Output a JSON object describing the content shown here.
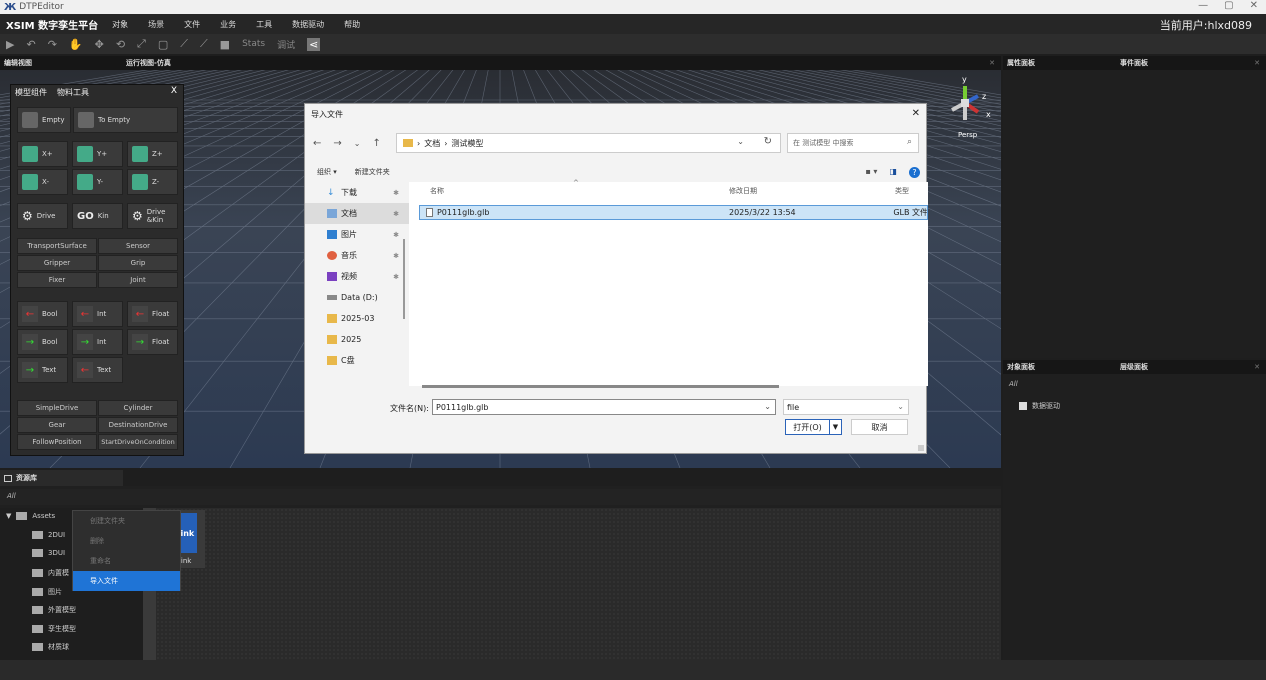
{
  "window": {
    "title": "DTPEditor",
    "controls": [
      "—",
      "▢",
      "✕"
    ]
  },
  "menubar": {
    "brand": "XSIM 数字孪生平台",
    "items": [
      "对象",
      "场景",
      "文件",
      "业务",
      "工具",
      "数据驱动",
      "帮助"
    ],
    "user": "当前用户:hlxd089"
  },
  "toolbar": {
    "stats": "Stats",
    "mode": "调试"
  },
  "panels": {
    "edit_view": "编辑视图",
    "run_view": "运行视图-仿真",
    "properties": "属性面板",
    "events": "事件面板",
    "objects": "对象面板",
    "hierarchy": "层级面板",
    "assets": "资源库"
  },
  "viewport": {
    "camera": "Persp",
    "axes": {
      "x": "x",
      "y": "y",
      "z": "z"
    }
  },
  "model_panel": {
    "tabs": [
      "模型组件",
      "物料工具"
    ],
    "close": "X",
    "empty_buttons": [
      "Empty",
      "To Empty"
    ],
    "axis_buttons": [
      "X+",
      "Y+",
      "Z+",
      "X-",
      "Y-",
      "Z-"
    ],
    "drive_buttons": [
      "Drive",
      "Kin",
      "Drive &Kin"
    ],
    "text_buttons": [
      "TransportSurface",
      "Sensor",
      "Gripper",
      "Grip",
      "Fixer",
      "Joint"
    ],
    "signal_buttons": [
      "Bool",
      "Int",
      "Float",
      "Bool",
      "Int",
      "Float",
      "Text",
      "Text"
    ],
    "bottom_buttons": [
      "SimpleDrive",
      "Cylinder",
      "Gear",
      "DestinationDrive",
      "FollowPosition",
      "StartDriveOnCondition"
    ]
  },
  "dialog": {
    "title": "导入文件",
    "breadcrumb": [
      "文档",
      "测试模型"
    ],
    "search_placeholder": "在 测试模型 中搜索",
    "organize": "组织 ▾",
    "new_folder": "新建文件夹",
    "sidebar": [
      {
        "label": "下载",
        "pinned": true
      },
      {
        "label": "文档",
        "pinned": true,
        "selected": true
      },
      {
        "label": "图片",
        "pinned": true
      },
      {
        "label": "音乐",
        "pinned": true
      },
      {
        "label": "视频",
        "pinned": true
      },
      {
        "label": "Data (D:)",
        "pinned": false
      },
      {
        "label": "2025-03",
        "pinned": false
      },
      {
        "label": "2025",
        "pinned": false
      },
      {
        "label": "C盘",
        "pinned": false
      }
    ],
    "columns": [
      "名称",
      "修改日期",
      "类型"
    ],
    "files": [
      {
        "name": "P0111glb.glb",
        "date": "2025/3/22 13:54",
        "type": "GLB 文件"
      }
    ],
    "filename_label": "文件名(N):",
    "filename_value": "P0111glb.glb",
    "filetype": "file",
    "open_label": "打开(O)",
    "cancel_label": "取消"
  },
  "objects_panel": {
    "filter": "All",
    "items": [
      "数据驱动"
    ]
  },
  "assets": {
    "filter": "All",
    "root": "Assets",
    "folders": [
      "2DUI",
      "3DUI",
      "内置模",
      "图片",
      "外置模型",
      "孪生模型",
      "材质球"
    ],
    "tile_label": "Link",
    "tile_icon_text": "link"
  },
  "context_menu": {
    "items": [
      {
        "label": "创建文件夹",
        "highlighted": false
      },
      {
        "label": "删除",
        "highlighted": false
      },
      {
        "label": "重命名",
        "highlighted": false
      },
      {
        "label": "导入文件",
        "highlighted": true
      }
    ]
  },
  "colors": {
    "accent": "#1f74d6",
    "selection": "#cce4f7",
    "green": "#33dd33",
    "red": "#ee3333"
  }
}
